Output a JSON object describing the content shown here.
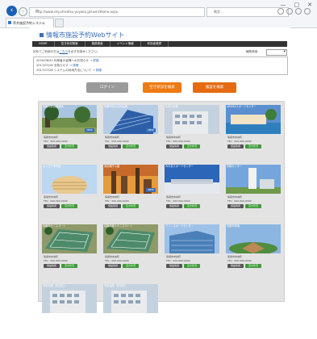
{
  "browser": {
    "window_controls": [
      "—",
      "□",
      "✕"
    ],
    "address": "http://www.city.shisetsu-yoyaku.jp/user/Home.aspx",
    "search_placeholder": "検索...",
    "tab_title": "公共施設予約システム"
  },
  "site": {
    "title": "情報市施設予約Webサイト",
    "nav": [
      "HOME",
      "空き状況検索",
      "施設検索",
      "イベント情報",
      "利用者登録"
    ],
    "intro_prefix": "初めてご利用の方は",
    "intro_link": "こちら",
    "intro_suffix": "を必ずお読みください。",
    "category_label": "種別検索",
    "news": [
      {
        "date": "2020/08/31",
        "text": "利用者の皆様へのお知らせ",
        "link": "詳細"
      },
      {
        "date": "2017/07/26",
        "text": "お知らせ２",
        "link": "詳細"
      },
      {
        "date": "2017/07/26",
        "text": "システムの利用方法について",
        "link": "詳細"
      }
    ],
    "buttons": {
      "login": "ログイン",
      "vacancy": "空き状況を検索",
      "facility": "施設を検索"
    }
  },
  "facilities": [
    {
      "name": "情報市総合運動場",
      "addr": "情報市中央町",
      "tel": "TEL：000-000-0000",
      "btn1": "施設情報",
      "btn2": "空き状況",
      "badge": "NEW",
      "photo": "park"
    },
    {
      "name": "情報市総合文化会館",
      "addr": "情報市中央町",
      "tel": "TEL：000-000-0000",
      "btn1": "施設情報",
      "btn2": "空き状況",
      "badge": "NEW",
      "photo": "building-blue"
    },
    {
      "name": "中央公民館",
      "addr": "情報市中央町",
      "tel": "TEL：000-000-0000",
      "btn1": "施設情報",
      "btn2": "空き状況",
      "badge": "",
      "photo": "building-grey"
    },
    {
      "name": "ARAMAスポーツセンター",
      "addr": "情報市中央町",
      "tel": "TEL：000-000-0000",
      "btn1": "施設情報",
      "btn2": "空き状況",
      "badge": "",
      "photo": "resort"
    },
    {
      "name": "小ぐすり体育館",
      "addr": "情報市中央町",
      "tel": "TEL：000-000-0000",
      "btn1": "施設情報",
      "btn2": "空き状況",
      "badge": "",
      "photo": "round-building"
    },
    {
      "name": "東京都庁公園",
      "addr": "情報市中央町",
      "tel": "TEL：000-000-0000",
      "btn1": "施設情報",
      "btn2": "空き状況",
      "badge": "NEW",
      "photo": "sunset"
    },
    {
      "name": "みのあスポーツセンター",
      "addr": "情報市中央町",
      "tel": "TEL：000-000-0000",
      "btn1": "施設情報",
      "btn2": "空き状況",
      "badge": "",
      "photo": "stadium"
    },
    {
      "name": "情報センター",
      "addr": "情報市中央町",
      "tel": "TEL：000-000-0000",
      "btn1": "施設情報",
      "btn2": "空き状況",
      "badge": "",
      "photo": "tower"
    },
    {
      "name": "情報市テニスコート",
      "addr": "情報市中央町",
      "tel": "TEL：000-000-0000",
      "btn1": "施設情報",
      "btn2": "空き状況",
      "badge": "",
      "photo": "tennis"
    },
    {
      "name": "情報市第２テニスコート",
      "addr": "情報市中央町",
      "tel": "TEL：000-000-0000",
      "btn1": "施設情報",
      "btn2": "空き状況",
      "badge": "",
      "photo": "tennis"
    },
    {
      "name": "マリンスポーツセンター",
      "addr": "情報市中央町",
      "tel": "TEL：000-000-0000",
      "btn1": "施設情報",
      "btn2": "空き状況",
      "badge": "",
      "photo": "building-glass"
    },
    {
      "name": "情報市球場",
      "addr": "情報市中央町",
      "tel": "TEL：000-000-0000",
      "btn1": "施設情報",
      "btn2": "空き状況",
      "badge": "",
      "photo": "ballpark"
    },
    {
      "name": "市民会館（多目的）",
      "addr": "",
      "tel": "",
      "btn1": "",
      "btn2": "",
      "badge": "",
      "photo": "building-grey"
    },
    {
      "name": "市民会館（多目的）",
      "addr": "",
      "tel": "",
      "btn1": "",
      "btn2": "",
      "badge": "",
      "photo": "building-grey"
    }
  ]
}
